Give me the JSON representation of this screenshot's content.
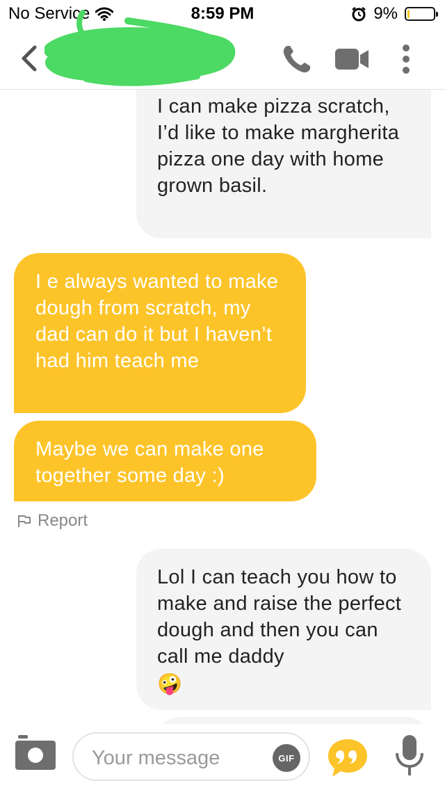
{
  "status_bar": {
    "carrier": "No Service",
    "time": "8:59 PM",
    "battery_percent": "9%",
    "battery_level": 0.09
  },
  "header": {
    "icons": [
      "back-chevron-icon",
      "phone-icon",
      "video-camera-icon",
      "more-vertical-icon"
    ]
  },
  "messages": [
    {
      "side": "sent",
      "text": "I can make pizza scratch, I’d like to make margherita pizza one day with home grown basil."
    },
    {
      "side": "received",
      "text": "I e always wanted to make dough from scratch, my dad can do it but I haven’t had him teach me"
    },
    {
      "side": "received",
      "text": "Maybe we can make one together some day :)"
    },
    {
      "side": "sent",
      "text": "Lol I can teach you how to make and raise the perfect dough and then you can call me daddy",
      "emoji": "🤪"
    }
  ],
  "report": {
    "label": "Report"
  },
  "composer": {
    "placeholder": "Your message",
    "gif_label": "GIF"
  },
  "colors": {
    "received_bubble": "#fdc42a",
    "sent_bubble": "#f4f4f4",
    "scribble": "#4cd964"
  }
}
